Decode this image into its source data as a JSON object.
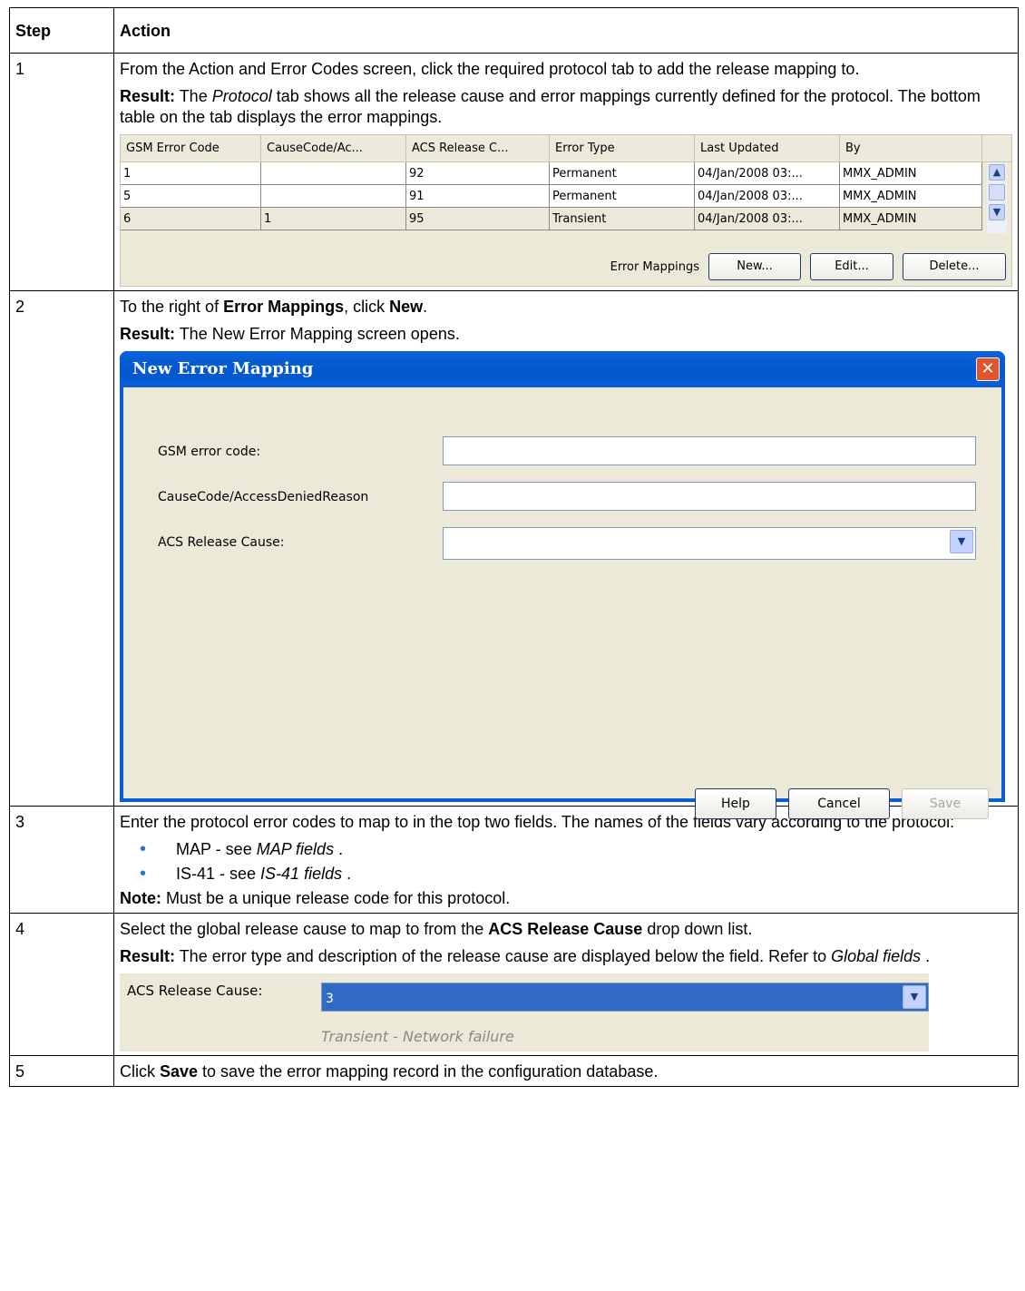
{
  "headers": {
    "step": "Step",
    "action": "Action"
  },
  "rows": [
    {
      "step": "1",
      "p1": "From the Action and Error Codes screen, click the required protocol tab to add the release mapping to.",
      "p2": {
        "bold": "Result:",
        "pre": " The ",
        "ital": "Protocol",
        "post": " tab shows all the release cause and error mappings currently defined for the protocol. The bottom table on the tab displays the error mappings."
      }
    },
    {
      "step": "2",
      "p1": {
        "pre": "To the right of ",
        "b1": "Error Mappings",
        "mid": ", click ",
        "b2": "New",
        "post": "."
      },
      "p2": {
        "bold": "Result:",
        "text": " The New Error Mapping screen opens."
      }
    },
    {
      "step": "3",
      "p1": "Enter the protocol error codes to map to in the top two fields. The names of the fields vary according to the protocol:",
      "bullets": [
        {
          "pre": "MAP - see ",
          "ital": "MAP fields",
          "post": " ."
        },
        {
          "pre": "IS-41 - see ",
          "ital": "IS-41 fields",
          "post": " ."
        }
      ],
      "note": {
        "bold": "Note:",
        "text": " Must be a unique release code for this protocol."
      }
    },
    {
      "step": "4",
      "p1": {
        "pre": "Select the global release cause to map to from the ",
        "b": "ACS Release Cause",
        "post": " drop down list."
      },
      "p2": {
        "bold": "Result:",
        "text": " The error type and description of the release cause are displayed below the field. Refer to ",
        "ital": "Global fields",
        "post": " ."
      }
    },
    {
      "step": "5",
      "p1": {
        "pre": "Click ",
        "b": "Save",
        "post": " to save the error mapping record in the configuration database."
      }
    }
  ],
  "grid": {
    "columns": [
      "GSM Error Code",
      "CauseCode/Ac...",
      "ACS Release C...",
      "Error Type",
      "Last Updated",
      "By"
    ],
    "rows": [
      [
        "1",
        "",
        "92",
        "Permanent",
        "04/Jan/2008 03:...",
        "MMX_ADMIN"
      ],
      [
        "5",
        "",
        "91",
        "Permanent",
        "04/Jan/2008 03:...",
        "MMX_ADMIN"
      ],
      [
        "6",
        "1",
        "95",
        "Transient",
        "04/Jan/2008 03:...",
        "MMX_ADMIN"
      ]
    ],
    "footer_label": "Error Mappings",
    "buttons": {
      "new": "New...",
      "edit": "Edit...",
      "delete": "Delete..."
    }
  },
  "dialog": {
    "title": "New Error Mapping",
    "fields": {
      "gsm": "GSM error code:",
      "cause": "CauseCode/AccessDeniedReason",
      "acs": "ACS Release Cause:"
    },
    "buttons": {
      "help": "Help",
      "cancel": "Cancel",
      "save": "Save"
    }
  },
  "release_cause": {
    "label": "ACS Release Cause:",
    "value": "3",
    "description": "Transient - Network failure"
  },
  "colors": {
    "dialog_title": "#0a5fd8",
    "selection": "#316ac5",
    "bullet": "#2e74c0",
    "window_bg": "#ece9d8"
  }
}
